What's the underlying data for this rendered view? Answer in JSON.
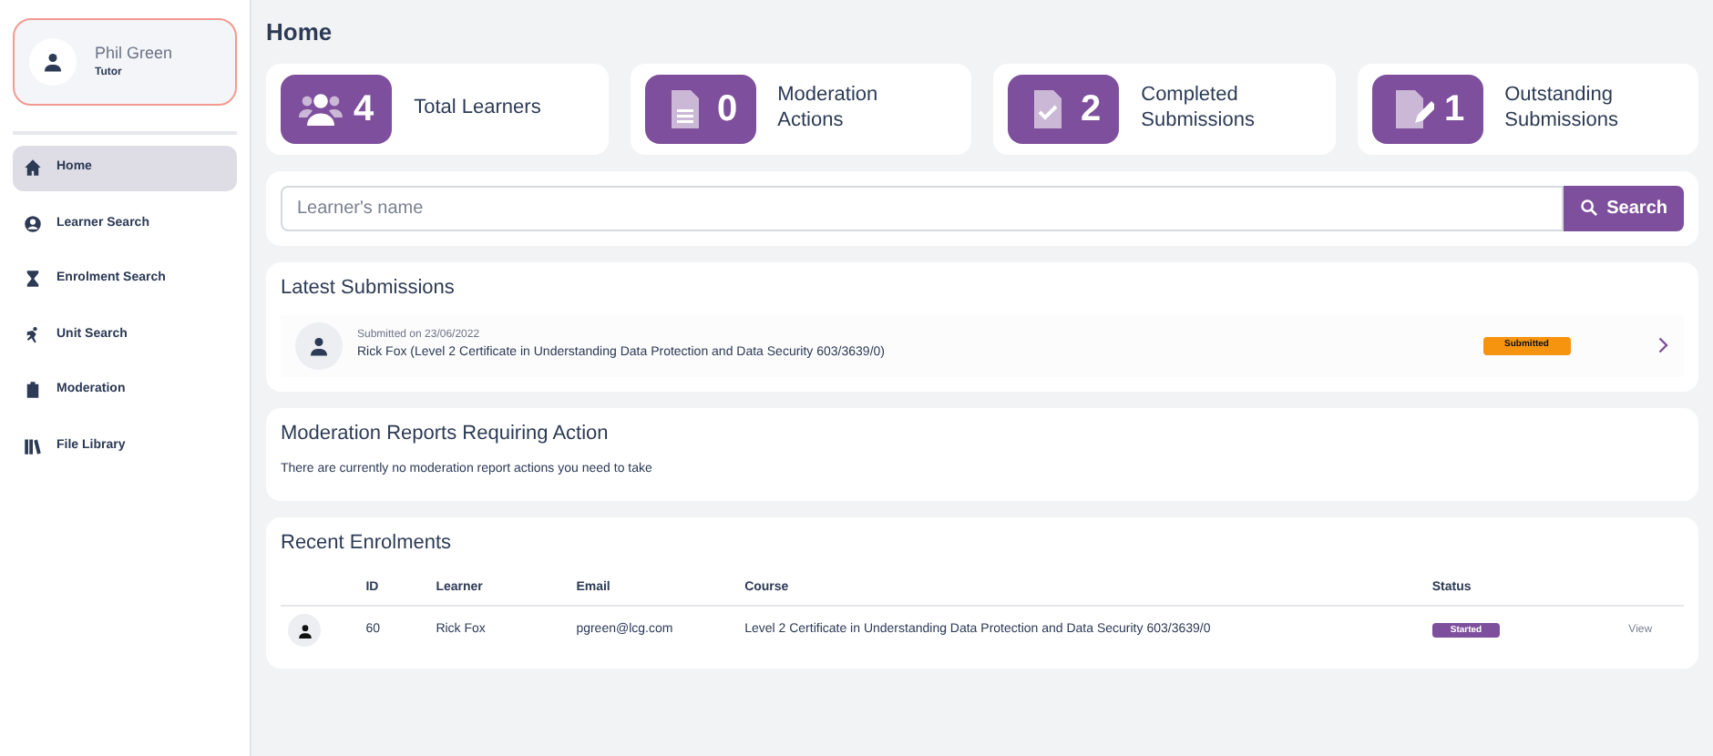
{
  "user": {
    "name": "Phil Green",
    "role": "Tutor"
  },
  "sidebar": {
    "items": [
      {
        "label": "Home",
        "selected": true
      },
      {
        "label": "Learner Search",
        "selected": false
      },
      {
        "label": "Enrolment Search",
        "selected": false
      },
      {
        "label": "Unit Search",
        "selected": false
      },
      {
        "label": "Moderation",
        "selected": false
      },
      {
        "label": "File Library",
        "selected": false
      }
    ]
  },
  "page_title": "Home",
  "stats": [
    {
      "count": "4",
      "label": "Total Learners"
    },
    {
      "count": "0",
      "label": "Moderation Actions"
    },
    {
      "count": "2",
      "label": "Completed Submissions"
    },
    {
      "count": "1",
      "label": "Outstanding Submissions"
    }
  ],
  "search": {
    "placeholder": "Learner's name",
    "button": "Search"
  },
  "latest_submissions": {
    "title": "Latest Submissions",
    "items": [
      {
        "date": "Submitted on 23/06/2022",
        "text": "Rick Fox (Level 2 Certificate in Understanding Data Protection and Data Security 603/3639/0)",
        "status": "Submitted"
      }
    ]
  },
  "moderation": {
    "title": "Moderation Reports Requiring Action",
    "message": "There are currently no moderation report actions you need to take"
  },
  "recent_enrolments": {
    "title": "Recent Enrolments",
    "columns": [
      "ID",
      "Learner",
      "Email",
      "Course",
      "Status"
    ],
    "rows": [
      {
        "id": "60",
        "learner": "Rick Fox",
        "email": "pgreen@lcg.com",
        "course": "Level 2 Certificate in Understanding Data Protection and Data Security 603/3639/0",
        "status": "Started",
        "action": "View"
      }
    ]
  }
}
